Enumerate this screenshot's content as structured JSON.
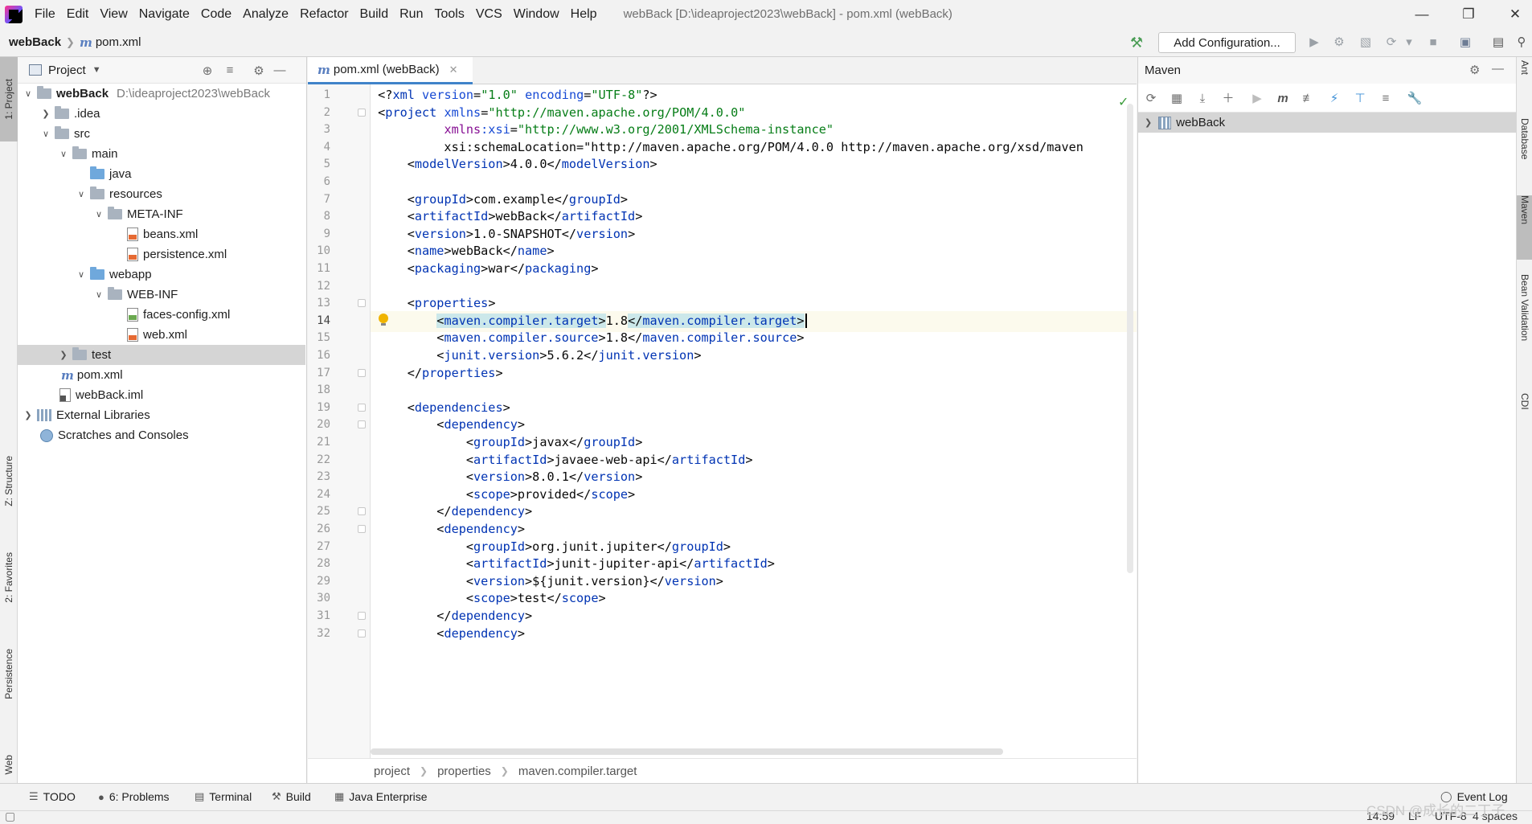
{
  "menubar": {
    "items": [
      "File",
      "Edit",
      "View",
      "Navigate",
      "Code",
      "Analyze",
      "Refactor",
      "Build",
      "Run",
      "Tools",
      "VCS",
      "Window",
      "Help"
    ],
    "window_title": "webBack [D:\\ideaproject2023\\webBack] - pom.xml (webBack)"
  },
  "navbar": {
    "project": "webBack",
    "file": "pom.xml",
    "add_configuration": "Add Configuration..."
  },
  "left_stripe": {
    "project_tab": "1: Project",
    "structure_tab": "Z: Structure",
    "favorites_tab": "2: Favorites",
    "persistence_tab": "Persistence",
    "web_tab": "Web"
  },
  "project_panel": {
    "title": "Project",
    "tree": [
      {
        "label": "webBack",
        "path": "D:\\ideaproject2023\\webBack"
      },
      {
        "label": ".idea"
      },
      {
        "label": "src"
      },
      {
        "label": "main"
      },
      {
        "label": "java"
      },
      {
        "label": "resources"
      },
      {
        "label": "META-INF"
      },
      {
        "label": "beans.xml"
      },
      {
        "label": "persistence.xml"
      },
      {
        "label": "webapp"
      },
      {
        "label": "WEB-INF"
      },
      {
        "label": "faces-config.xml"
      },
      {
        "label": "web.xml"
      },
      {
        "label": "test"
      },
      {
        "label": "pom.xml"
      },
      {
        "label": "webBack.iml"
      },
      {
        "label": "External Libraries"
      },
      {
        "label": "Scratches and Consoles"
      }
    ]
  },
  "editor": {
    "tab_label": "pom.xml (webBack)",
    "current_line": 14,
    "line_numbers": [
      "1",
      "2",
      "3",
      "4",
      "5",
      "6",
      "7",
      "8",
      "9",
      "10",
      "11",
      "12",
      "13",
      "14",
      "15",
      "16",
      "17",
      "18",
      "19",
      "20",
      "21",
      "22",
      "23",
      "24",
      "25",
      "26",
      "27",
      "28",
      "29",
      "30",
      "31",
      "32"
    ],
    "lines": [
      "<?xml version=\"1.0\" encoding=\"UTF-8\"?>",
      "<project xmlns=\"http://maven.apache.org/POM/4.0.0\"",
      "         xmlns:xsi=\"http://www.w3.org/2001/XMLSchema-instance\"",
      "         xsi:schemaLocation=\"http://maven.apache.org/POM/4.0.0 http://maven.apache.org/xsd/maven",
      "    <modelVersion>4.0.0</modelVersion>",
      "",
      "    <groupId>com.example</groupId>",
      "    <artifactId>webBack</artifactId>",
      "    <version>1.0-SNAPSHOT</version>",
      "    <name>webBack</name>",
      "    <packaging>war</packaging>",
      "",
      "    <properties>",
      "        <maven.compiler.target>1.8</maven.compiler.target>",
      "        <maven.compiler.source>1.8</maven.compiler.source>",
      "        <junit.version>5.6.2</junit.version>",
      "    </properties>",
      "",
      "    <dependencies>",
      "        <dependency>",
      "            <groupId>javax</groupId>",
      "            <artifactId>javaee-web-api</artifactId>",
      "            <version>8.0.1</version>",
      "            <scope>provided</scope>",
      "        </dependency>",
      "        <dependency>",
      "            <groupId>org.junit.jupiter</groupId>",
      "            <artifactId>junit-jupiter-api</artifactId>",
      "            <version>${junit.version}</version>",
      "            <scope>test</scope>",
      "        </dependency>",
      "        <dependency>"
    ],
    "breadcrumbs": [
      "project",
      "properties",
      "maven.compiler.target"
    ]
  },
  "maven_panel": {
    "title": "Maven",
    "root": "webBack"
  },
  "right_stripe": {
    "ant_tab": "Ant",
    "database_tab": "Database",
    "maven_tab": "Maven",
    "bean_validation_tab": "Bean Validation",
    "cdi_tab": "CDI"
  },
  "bottom_bar": {
    "todo": "TODO",
    "problems": "6: Problems",
    "terminal": "Terminal",
    "build": "Build",
    "java_enterprise": "Java Enterprise",
    "event_log": "Event Log"
  },
  "status_bar": {
    "time": "14:59",
    "line_sep": "LF",
    "encoding": "UTF-8",
    "indent": "4 spaces"
  },
  "watermark": "CSDN @成长的二丁子"
}
